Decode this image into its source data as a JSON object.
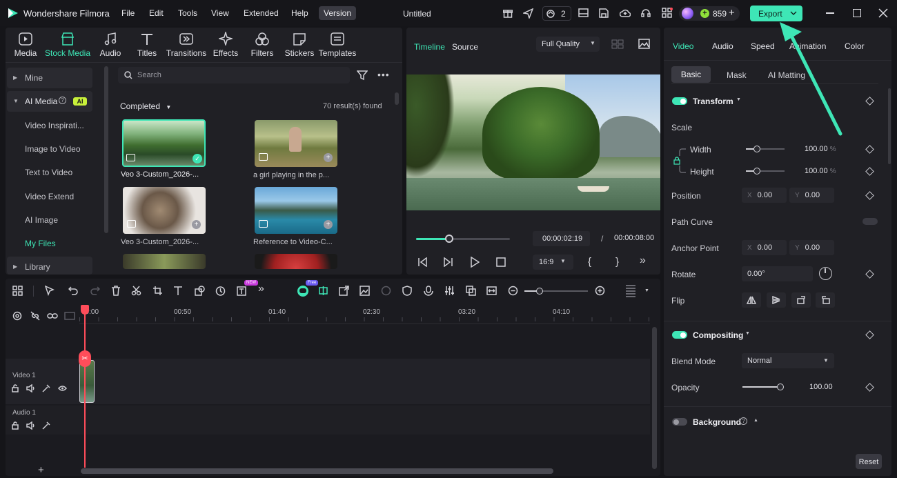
{
  "app": {
    "name": "Wondershare Filmora",
    "project_title": "Untitled"
  },
  "menu": [
    "File",
    "Edit",
    "Tools",
    "View",
    "Extended",
    "Help",
    "Version"
  ],
  "titlebar": {
    "collab_count": "2",
    "credits": "859",
    "export_label": "Export"
  },
  "media_tabs": [
    "Media",
    "Stock Media",
    "Audio",
    "Titles",
    "Transitions",
    "Effects",
    "Filters",
    "Stickers",
    "Templates"
  ],
  "sidebar": {
    "items": [
      "Mine",
      "AI Media",
      "Video Inspirati...",
      "Image to Video",
      "Text to Video",
      "Video Extend",
      "AI Image",
      "My Files",
      "Library"
    ],
    "ai_badge": "AI"
  },
  "search": {
    "placeholder": "Search"
  },
  "results": {
    "filter": "Completed",
    "count": "70 result(s) found"
  },
  "thumbs": [
    "Veo 3-Custom_2026-...",
    "a girl playing in the p...",
    "Veo 3-Custom_2026-...",
    "Reference to Video-C..."
  ],
  "preview": {
    "tab_timeline": "Timeline",
    "tab_source": "Source",
    "quality": "Full Quality",
    "current_time": "00:00:02:19",
    "separator": "/",
    "total_time": "00:00:08:00",
    "aspect": "16:9",
    "progress": 0.35
  },
  "inspector": {
    "tabs": [
      "Video",
      "Audio",
      "Speed",
      "Animation",
      "Color"
    ],
    "subtabs": [
      "Basic",
      "Mask",
      "AI Matting"
    ],
    "transform": "Transform",
    "scale": "Scale",
    "width_label": "Width",
    "width_value": "100.00",
    "width_unit": "%",
    "height_label": "Height",
    "height_value": "100.00",
    "height_unit": "%",
    "position": "Position",
    "pos_x_label": "X",
    "pos_x": "0.00",
    "pos_y_label": "Y",
    "pos_y": "0.00",
    "path_curve": "Path Curve",
    "anchor_point": "Anchor Point",
    "anchor_x_label": "X",
    "anchor_x": "0.00",
    "anchor_y_label": "Y",
    "anchor_y": "0.00",
    "rotate": "Rotate",
    "rotate_value": "0.00°",
    "flip": "Flip",
    "compositing": "Compositing",
    "blend_mode": "Blend Mode",
    "blend_value": "Normal",
    "opacity": "Opacity",
    "opacity_value": "100.00",
    "background": "Background",
    "reset": "Reset"
  },
  "timeline": {
    "ruler": [
      "00:00",
      "00:50",
      "01:40",
      "02:30",
      "03:20",
      "04:10"
    ],
    "tracks": [
      "Video 1",
      "Audio 1"
    ],
    "badge_new": "NEW",
    "badge_free": "Free"
  },
  "colors": {
    "accent": "#3ee6b6",
    "playhead": "#ff4d5a",
    "background": "#151519",
    "panel": "#202025"
  }
}
